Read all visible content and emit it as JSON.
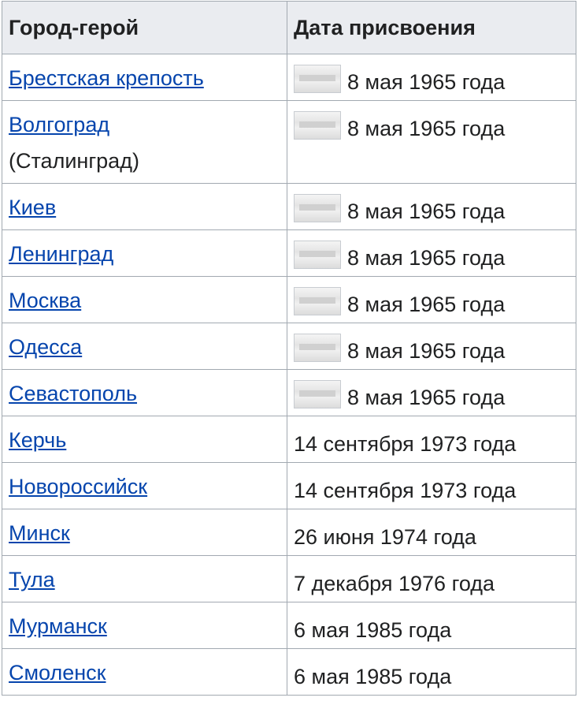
{
  "header": {
    "city": "Город-герой",
    "date": "Дата присвоения"
  },
  "rows": [
    {
      "city": "Брестская крепость",
      "sub": "",
      "date": "8 мая 1965 года",
      "has_image": true
    },
    {
      "city": "Волгоград",
      "sub": "(Сталинград)",
      "date": "8 мая 1965 года",
      "has_image": true
    },
    {
      "city": "Киев",
      "sub": "",
      "date": "8 мая 1965 года",
      "has_image": true
    },
    {
      "city": "Ленинград",
      "sub": "",
      "date": "8 мая 1965 года",
      "has_image": true
    },
    {
      "city": "Москва",
      "sub": "",
      "date": "8 мая 1965 года",
      "has_image": true
    },
    {
      "city": "Одесса",
      "sub": "",
      "date": "8 мая 1965 года",
      "has_image": true
    },
    {
      "city": "Севастополь",
      "sub": "",
      "date": "8 мая 1965 года",
      "has_image": true
    },
    {
      "city": "Керчь",
      "sub": "",
      "date": "14 сентября 1973 года",
      "has_image": false
    },
    {
      "city": "Новороссийск",
      "sub": "",
      "date": "14 сентября 1973 года",
      "has_image": false
    },
    {
      "city": "Минск",
      "sub": "",
      "date": "26 июня 1974 года",
      "has_image": false
    },
    {
      "city": "Тула",
      "sub": "",
      "date": "7 декабря 1976 года",
      "has_image": false
    },
    {
      "city": "Мурманск",
      "sub": "",
      "date": "6 мая 1985 года",
      "has_image": false
    },
    {
      "city": "Смоленск",
      "sub": "",
      "date": "6 мая 1985 года",
      "has_image": false
    }
  ],
  "colors": {
    "link": "#0645ad",
    "header_bg": "#eaecf0",
    "border": "#a2a9b1"
  }
}
